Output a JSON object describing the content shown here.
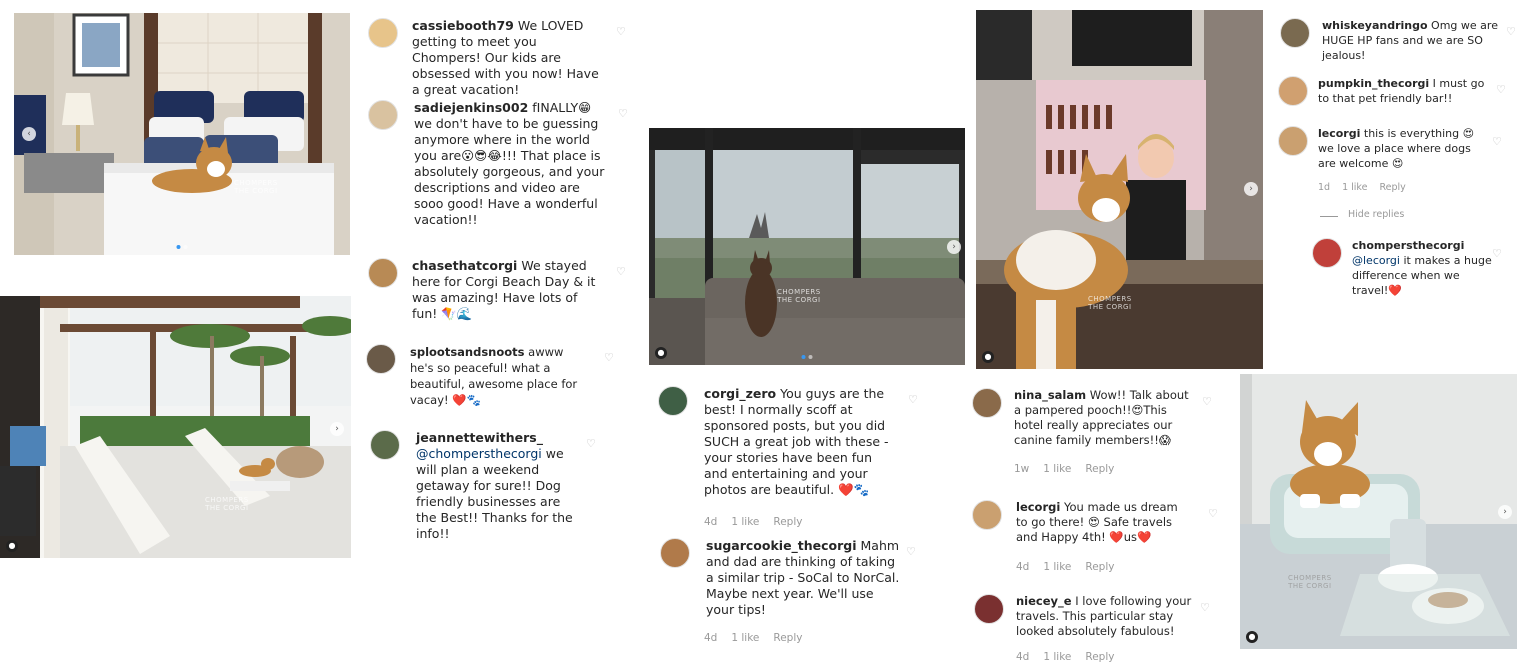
{
  "colors": {
    "heart_red": "#ed4956",
    "mention": "#003569",
    "meta_gray": "#999999",
    "carousel_active": "#3897f0"
  },
  "icons": {
    "like": "heart-outline-icon",
    "carousel_next": "chevron-right-icon",
    "carousel_prev": "chevron-left-icon",
    "tagged": "person-tag-icon"
  },
  "watermark": [
    "CHOMPERS",
    "THE CORGI"
  ],
  "col1": {
    "comments": [
      {
        "user": "cassiebooth79",
        "text": " We LOVED getting to meet you Chompers! Our kids are obsessed with you now! Have a great vacation!"
      },
      {
        "user": "sadiejenkins002",
        "text": " fINALLY😁 we don't have to be guessing anymore where in the world you are😮😎😂!!! That place is absolutely gorgeous, and your descriptions and video are sooo good! Have a wonderful vacation!!"
      },
      {
        "user": "chasethatcorgi",
        "text": " We stayed here for Corgi Beach Day & it was amazing! Have lots of fun! 🪁🌊"
      },
      {
        "user": "splootsandsnoots",
        "text": " awww he's so peaceful! what a beautiful, awesome place for vacay! ❤️🐾"
      },
      {
        "user": "jeannettewithers_",
        "mention": "@chompersthecorgi",
        "text": " we will plan a weekend getaway for sure!! Dog friendly businesses are the Best!! Thanks for the info!!"
      }
    ]
  },
  "col2": {
    "comments": [
      {
        "user": "corgi_zero",
        "text": " You guys are the best! I normally scoff at sponsored posts, but you did SUCH a great job with these - your stories have been fun and entertaining and your photos are beautiful. ❤️🐾",
        "time": "4d",
        "likes": "1 like",
        "reply": "Reply"
      },
      {
        "user": "sugarcookie_thecorgi",
        "text": " Mahm and dad are thinking of taking a similar trip - SoCal to NorCal. Maybe next year. We'll use your tips!",
        "time": "4d",
        "likes": "1 like",
        "reply": "Reply"
      }
    ]
  },
  "col3": {
    "comments": [
      {
        "user": "whiskeyandringo",
        "text": " Omg we are HUGE HP fans and we are SO jealous!"
      },
      {
        "user": "pumpkin_thecorgi",
        "text": " I must go to that pet friendly bar!!"
      },
      {
        "user": "lecorgi",
        "text": " this is everything 😍 we love a place where dogs are welcome 😍",
        "time": "1d",
        "likes": "1 like",
        "reply": "Reply"
      }
    ],
    "hide_replies": "Hide replies",
    "reply": {
      "user": "chompersthecorgi",
      "mention": "@lecorgi",
      "text": " it makes a huge difference when we travel!❤️"
    }
  },
  "col4": {
    "comments": [
      {
        "user": "nina_salam",
        "text": " Wow!! Talk about a pampered pooch!!😍This hotel really appreciates our canine family members!!😱",
        "time": "1w",
        "likes": "1 like",
        "reply": "Reply"
      },
      {
        "user": "lecorgi",
        "text": " You made us dream to go there! 😍 Safe travels and Happy 4th! ❤️us❤️",
        "time": "4d",
        "likes": "1 like",
        "reply": "Reply"
      },
      {
        "user": "niecey_e",
        "text": " I love following your travels. This particular stay looked absolutely fabulous!",
        "time": "4d",
        "likes": "1 like",
        "reply": "Reply"
      }
    ]
  }
}
